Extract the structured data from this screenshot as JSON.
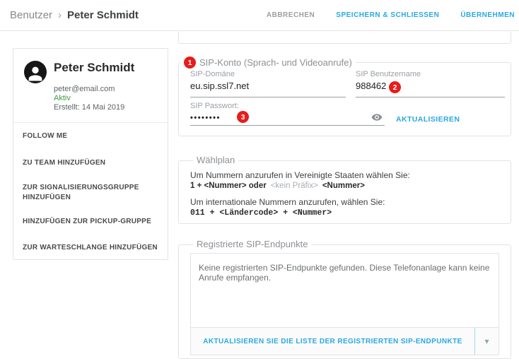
{
  "breadcrumb": {
    "parent": "Benutzer",
    "separator": "›",
    "current": "Peter Schmidt"
  },
  "header_actions": {
    "cancel": "ABBRECHEN",
    "save_close": "SPEICHERN & SCHLIESSEN",
    "apply": "ÜBERNEHMEN"
  },
  "profile": {
    "name": "Peter Schmidt",
    "email": "peter@email.com",
    "status": "Aktiv",
    "created": "Erstellt: 14 Mai 2019"
  },
  "sidebar": {
    "items": [
      {
        "label": "FOLLOW ME"
      },
      {
        "label": "ZU TEAM HINZUFÜGEN"
      },
      {
        "label": "ZUR SIGNALISIERUNGSGRUPPE HINZUFÜGEN"
      },
      {
        "label": "HINZUFÜGEN ZUR PICKUP-GRUPPE"
      },
      {
        "label": "ZUR WARTESCHLANGE HINZUFÜGEN"
      }
    ]
  },
  "sip_account": {
    "legend": "SIP-Konto (Sprach- und Videoanrufe)",
    "badge_1": "1",
    "badge_2": "2",
    "badge_3": "3",
    "domain_label": "SIP-Domäne",
    "domain_value": "eu.sip.ssl7.net",
    "username_label": "SIP Benutzername",
    "username_value": "988462",
    "password_label": "SIP Passwort:",
    "password_value": "••••••••",
    "update_label": "AKTUALISIEREN"
  },
  "dialplan": {
    "legend": "Wählplan",
    "us_instruction": "Um Nummern anzurufen in Vereinigte Staaten wählen Sie:",
    "us_pattern_start": "1 + <Nummer> oder",
    "us_pattern_muted": "<kein Präfix>",
    "us_pattern_end": "<Nummer>",
    "intl_instruction": "Um internationale Nummern anzurufen, wählen Sie:",
    "intl_pattern": "011 + <Ländercode> + <Nummer>"
  },
  "endpoints": {
    "legend": "Registrierte SIP-Endpunkte",
    "empty_message": "Keine registrierten SIP-Endpunkte gefunden. Diese Telefonanlage kann keine Anrufe empfangen.",
    "refresh_label": "AKTUALISIEREN SIE DIE LISTE DER REGISTRIERTEN SIP-ENDPUNKTE",
    "caret": "▾"
  },
  "colors": {
    "accent_blue": "#29a8e2",
    "badge_red": "#e81c1c",
    "status_green": "#3d9c40"
  }
}
